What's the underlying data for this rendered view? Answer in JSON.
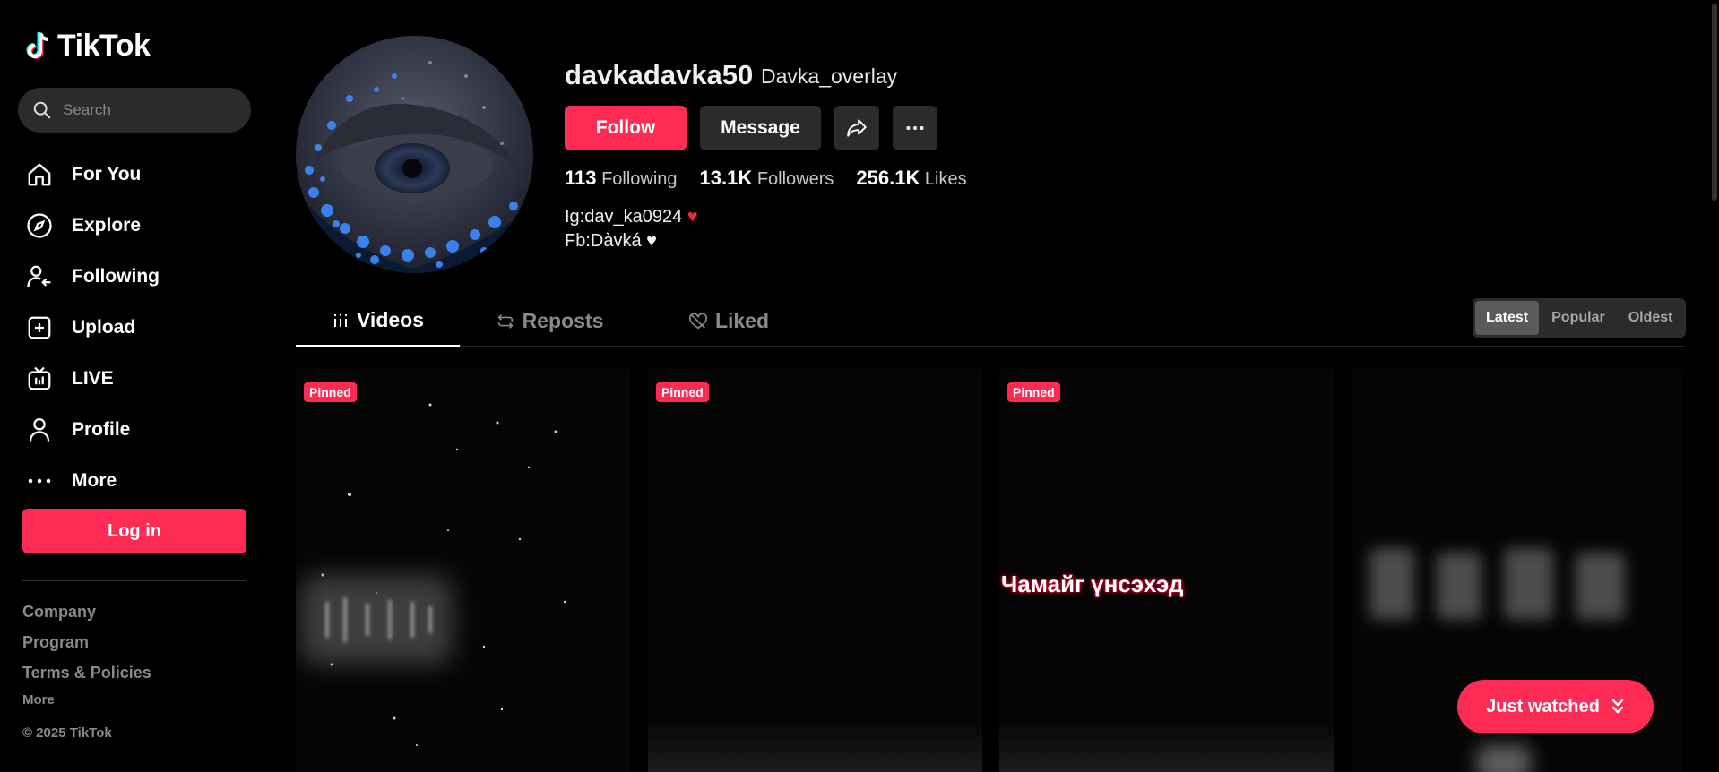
{
  "app": {
    "name": "TikTok"
  },
  "search": {
    "placeholder": "Search"
  },
  "nav": [
    {
      "label": "For You",
      "icon": "home-icon"
    },
    {
      "label": "Explore",
      "icon": "compass-icon"
    },
    {
      "label": "Following",
      "icon": "following-icon"
    },
    {
      "label": "Upload",
      "icon": "upload-icon"
    },
    {
      "label": "LIVE",
      "icon": "live-icon"
    },
    {
      "label": "Profile",
      "icon": "profile-icon"
    },
    {
      "label": "More",
      "icon": "more-icon"
    }
  ],
  "login": {
    "label": "Log in"
  },
  "footer": {
    "links": [
      "Company",
      "Program",
      "Terms & Policies"
    ],
    "more": "More",
    "copyright": "© 2025 TikTok"
  },
  "profile": {
    "username": "davkadavka50",
    "nickname": "Davka_overlay",
    "follow_label": "Follow",
    "message_label": "Message",
    "stats": [
      {
        "value": "113",
        "label": "Following"
      },
      {
        "value": "13.1K",
        "label": "Followers"
      },
      {
        "value": "256.1K",
        "label": "Likes"
      }
    ],
    "bio": [
      "Ig:dav_ka0924",
      "Fb:Dàvká"
    ]
  },
  "tabs": [
    {
      "label": "Videos",
      "icon": "grid-icon",
      "active": true
    },
    {
      "label": "Reposts",
      "icon": "repost-icon",
      "active": false
    },
    {
      "label": "Liked",
      "icon": "liked-heart-icon",
      "active": false
    }
  ],
  "sort": [
    {
      "label": "Latest",
      "active": true
    },
    {
      "label": "Popular",
      "active": false
    },
    {
      "label": "Oldest",
      "active": false
    }
  ],
  "videos": [
    {
      "badge": "Pinned",
      "caption": ""
    },
    {
      "badge": "Pinned",
      "caption": ""
    },
    {
      "badge": "Pinned",
      "caption": "Чамайг үнсэхэд"
    },
    {
      "badge": "",
      "caption": ""
    }
  ],
  "just_watched": {
    "label": "Just watched"
  },
  "colors": {
    "accent": "#fe2c55",
    "background": "#000000",
    "surface": "#2b2b2b"
  }
}
